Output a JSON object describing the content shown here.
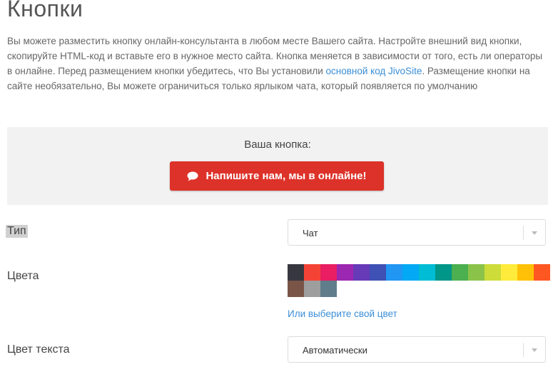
{
  "page": {
    "title": "Кнопки",
    "description_before_link": "Вы можете разместить кнопку онлайн-консультанта в любом месте Вашего сайта. Настройте внешний вид кнопки, скопируйте HTML-код и вставьте его в нужное место сайта. Кнопка меняется в зависимости от того, есть ли операторы в онлайне. Перед размещением кнопки убедитесь, что Вы установили ",
    "description_link": "основной код JivoSite",
    "description_after_link": ". Размещение кнопки на сайте необязательно, Вы можете ограничиться только ярлыком чата, который появляется по умолчанию"
  },
  "preview": {
    "label": "Ваша кнопка:",
    "button_text": "Напишите нам, мы в онлайне!",
    "button_icon": "chat-bubble-icon",
    "button_color": "#dd3229"
  },
  "type_field": {
    "label": "Тип",
    "value": "Чат"
  },
  "colors_field": {
    "label": "Цвета",
    "swatches": [
      "#37383f",
      "#f44336",
      "#e91e63",
      "#9c27b0",
      "#673ab7",
      "#3f51b5",
      "#2196f3",
      "#03a9f4",
      "#00bcd4",
      "#009688",
      "#4caf50",
      "#8bc34a",
      "#cddc39",
      "#ffeb3b",
      "#ffc107",
      "#ff5722",
      "#795548",
      "#9e9e9e",
      "#607d8b"
    ],
    "custom_link": "Или выберите свой цвет"
  },
  "text_color_field": {
    "label": "Цвет текста",
    "value": "Автоматически"
  }
}
